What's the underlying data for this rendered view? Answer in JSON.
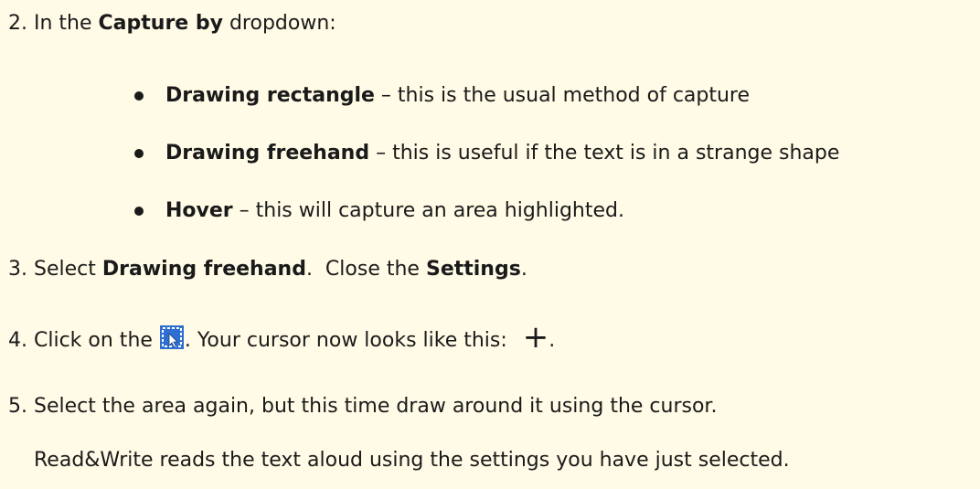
{
  "steps": [
    {
      "number": "2.",
      "pre": "In the ",
      "bold": "Capture by",
      "post": " dropdown:"
    },
    {
      "number": "3.",
      "pre": "Select ",
      "bold": "Drawing freehand",
      "mid": ".  Close the ",
      "bold2": "Settings",
      "post": "."
    },
    {
      "number": "4.",
      "pre": "Click on the ",
      "mid": ". Your cursor now looks like this: ",
      "cursor_glyph": "+",
      "post": "."
    },
    {
      "number": "5.",
      "text": "Select the area again, but this time draw around it using the cursor."
    }
  ],
  "bullets": [
    {
      "bold": "Drawing rectangle",
      "text": " – this is the usual method of capture"
    },
    {
      "bold": "Drawing freehand",
      "text": " – this is useful if the text is in a strange shape"
    },
    {
      "bold": "Hover",
      "text": " – this will capture an area highlighted."
    }
  ],
  "result_text": "Read&Write reads the text aloud using the settings you have just selected.",
  "icons": {
    "capture": "screen-capture-icon",
    "cursor": "crosshair-cursor-icon"
  },
  "colors": {
    "background": "#fffbe6",
    "icon_blue": "#2f6fd1"
  }
}
